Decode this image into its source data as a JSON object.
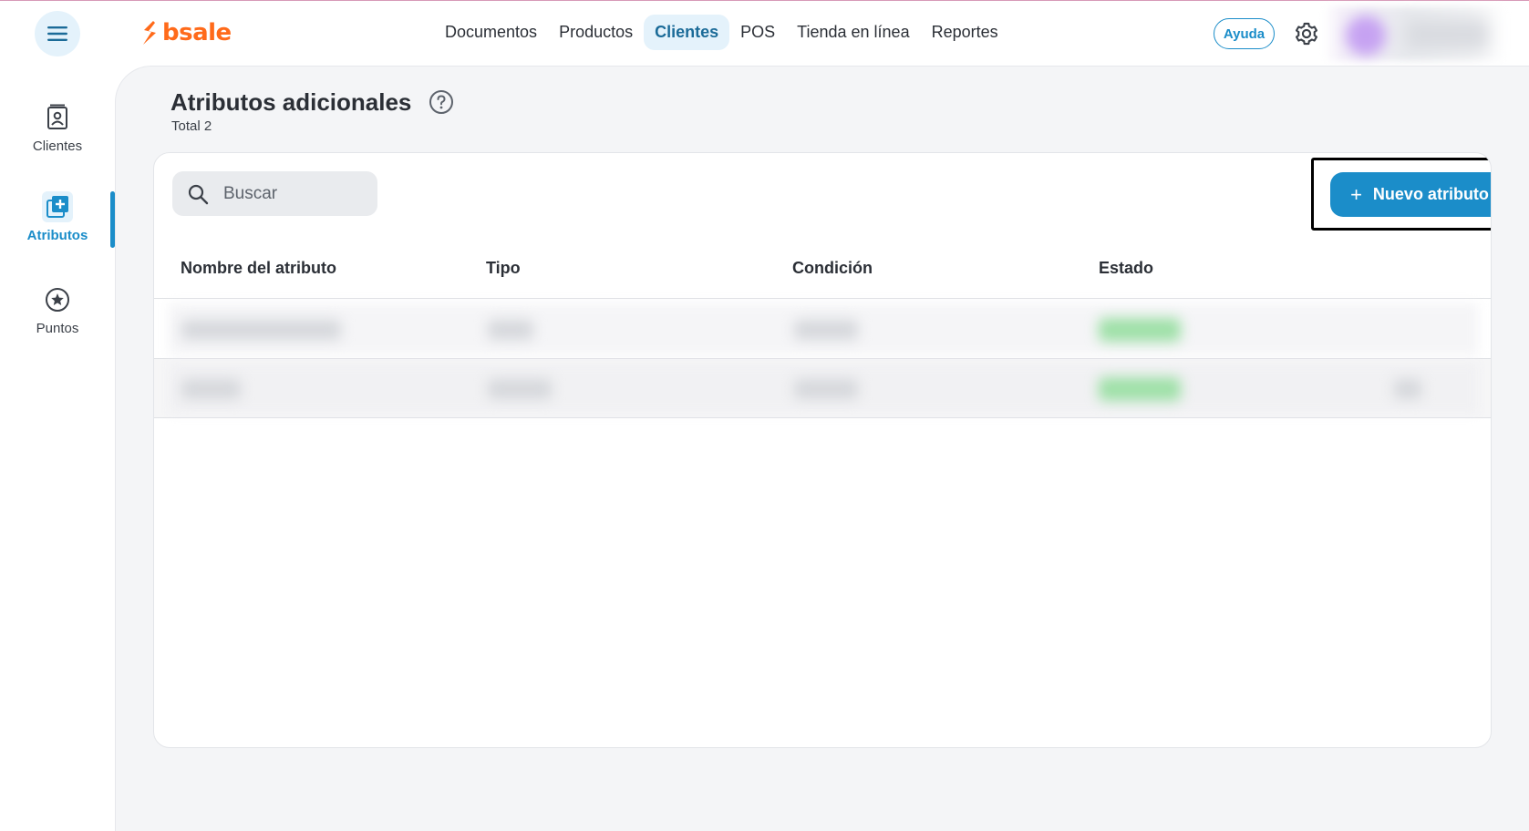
{
  "header": {
    "logo_text": "bsale",
    "nav": [
      {
        "label": "Documentos",
        "active": false
      },
      {
        "label": "Productos",
        "active": false
      },
      {
        "label": "Clientes",
        "active": true
      },
      {
        "label": "POS",
        "active": false
      },
      {
        "label": "Tienda en línea",
        "active": false
      },
      {
        "label": "Reportes",
        "active": false
      }
    ],
    "help_label": "Ayuda"
  },
  "sidebar": {
    "items": [
      {
        "label": "Clientes",
        "icon": "contact-card-icon",
        "active": false
      },
      {
        "label": "Atributos",
        "icon": "add-attribute-icon",
        "active": true
      },
      {
        "label": "Puntos",
        "icon": "star-circle-icon",
        "active": false
      }
    ]
  },
  "page": {
    "title": "Atributos adicionales",
    "total": "Total 2"
  },
  "toolbar": {
    "search_placeholder": "Buscar",
    "new_button_label": "Nuevo atributo"
  },
  "table": {
    "columns": [
      "Nombre del atributo",
      "Tipo",
      "Condición",
      "Estado"
    ],
    "row_count": 2
  },
  "colors": {
    "brand": "#ff6a1a",
    "accent": "#1b8dc9",
    "nav_active_bg": "#e4f2fb",
    "status_active": "#9fe0a8"
  }
}
